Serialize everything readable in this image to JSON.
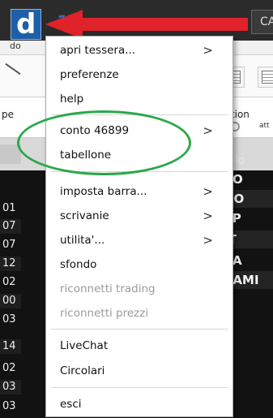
{
  "background": {
    "logo_letter": "d",
    "logo_number": "15",
    "tab_right": "CA",
    "address_fragment": "do",
    "tab_left": "pe",
    "tab_positions": "osition",
    "tab_att": "att",
    "column_header": "itolo",
    "left_numbers": [
      "01",
      "07",
      "07",
      "12",
      "02",
      "00",
      "03",
      "14",
      "02",
      "03",
      "03"
    ],
    "right_symbols": [
      "XO",
      "DO",
      "SP",
      "IT",
      "CA",
      "BAMI"
    ]
  },
  "menu": {
    "items": [
      {
        "label": "apri tessera...",
        "submenu": true,
        "enabled": true
      },
      {
        "label": "preferenze",
        "submenu": false,
        "enabled": true
      },
      {
        "label": "help",
        "submenu": false,
        "enabled": true
      },
      {
        "label": "conto 46899",
        "submenu": true,
        "enabled": true
      },
      {
        "label": "tabellone",
        "submenu": false,
        "enabled": true
      },
      {
        "label": "imposta barra...",
        "submenu": true,
        "enabled": true
      },
      {
        "label": "scrivanie",
        "submenu": true,
        "enabled": true
      },
      {
        "label": "utilita'...",
        "submenu": true,
        "enabled": true
      },
      {
        "label": "sfondo",
        "submenu": false,
        "enabled": true
      },
      {
        "label": "riconnetti trading",
        "submenu": false,
        "enabled": false
      },
      {
        "label": "riconnetti prezzi",
        "submenu": false,
        "enabled": false
      },
      {
        "label": "LiveChat",
        "submenu": false,
        "enabled": true
      },
      {
        "label": "Circolari",
        "submenu": false,
        "enabled": true
      },
      {
        "label": "esci",
        "submenu": false,
        "enabled": true
      }
    ],
    "chevron": ">"
  },
  "annotations": {
    "arrow_color": "#e0222b",
    "ellipse_color": "#2aa84a"
  }
}
